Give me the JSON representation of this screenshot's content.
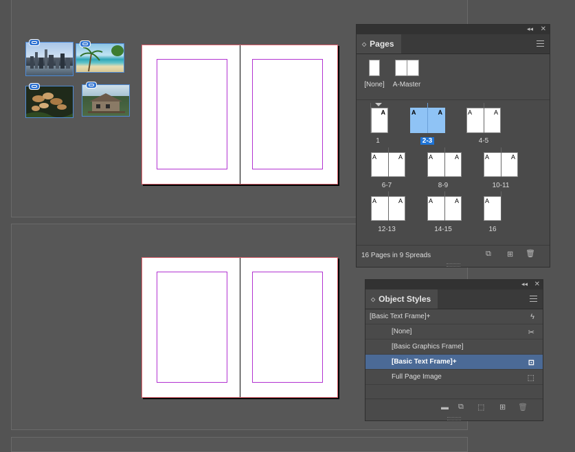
{
  "pages_panel": {
    "title": "Pages",
    "masters": [
      {
        "label": "[None]"
      },
      {
        "label": "A-Master"
      }
    ],
    "spreads": [
      {
        "label": "1",
        "selected": false
      },
      {
        "label": "2-3",
        "selected": true
      },
      {
        "label": "4-5",
        "selected": false
      },
      {
        "label": "6-7",
        "selected": false
      },
      {
        "label": "8-9",
        "selected": false
      },
      {
        "label": "10-11",
        "selected": false
      },
      {
        "label": "12-13",
        "selected": false
      },
      {
        "label": "14-15",
        "selected": false
      },
      {
        "label": "16",
        "selected": false
      }
    ],
    "master_letter": "A",
    "status": "16 Pages in 9 Spreads"
  },
  "object_styles_panel": {
    "title": "Object Styles",
    "current_style": "[Basic Text Frame]+",
    "items": [
      {
        "label": "[None]",
        "selected": false,
        "icon": "scissors-icon"
      },
      {
        "label": "[Basic Graphics Frame]",
        "selected": false,
        "icon": ""
      },
      {
        "label": "[Basic Text Frame]+",
        "selected": true,
        "icon": "text-frame-icon"
      },
      {
        "label": "Full Page Image",
        "selected": false,
        "icon": "frame-icon"
      }
    ]
  },
  "colors": {
    "pasteboard": "#535353",
    "panel_bg": "#4a4a4a",
    "selection_blue": "#1f74d6",
    "selected_row": "#4b6a96",
    "bleed_red": "#e0606c",
    "margin_purple": "#b12fd0",
    "link_badge": "#2f73d1"
  },
  "placed_images": [
    {
      "name": "city-skyline-image"
    },
    {
      "name": "beach-palms-image"
    },
    {
      "name": "mushrooms-image"
    },
    {
      "name": "cabin-image"
    }
  ]
}
